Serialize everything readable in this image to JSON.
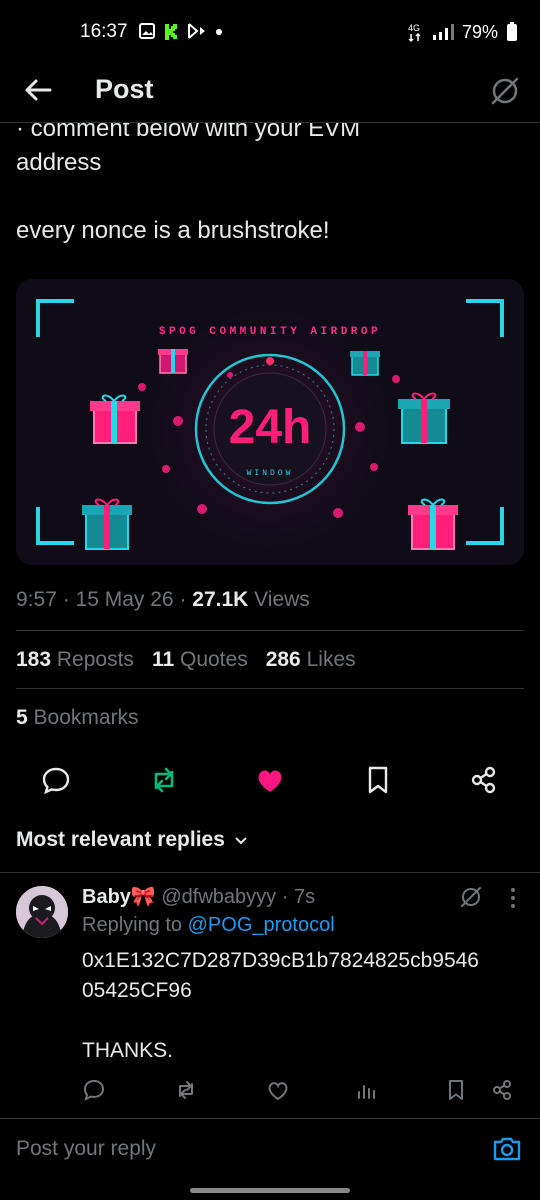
{
  "status_bar": {
    "time": "16:37",
    "network": "4G",
    "battery": "79%"
  },
  "header": {
    "title": "Post"
  },
  "tweet": {
    "text": "· comment below with your EVM\naddress\n\nevery nonce is a brushstroke!"
  },
  "media": {
    "banner": "$POG COMMUNITY AIRDROP",
    "big": "24h",
    "sub": "WINDOW"
  },
  "meta": {
    "time": "9:57",
    "date": "15 May 26",
    "views_count": "27.1K",
    "views_label": "Views"
  },
  "stats": {
    "reposts_count": "183",
    "reposts_label": "Reposts",
    "quotes_count": "11",
    "quotes_label": "Quotes",
    "likes_count": "286",
    "likes_label": "Likes",
    "bookmarks_count": "5",
    "bookmarks_label": "Bookmarks"
  },
  "replies_sort": {
    "label": "Most relevant replies"
  },
  "reply": {
    "name": "Baby🎀",
    "handle": "@dfwbabyyy",
    "age": "7s",
    "replying_prefix": "Replying to",
    "replying_to": "@POG_protocol",
    "body": "0x1E132C7D287D39cB1b7824825cb9546\n05425CF96\n\nTHANKS."
  },
  "composer": {
    "placeholder": "Post your reply"
  },
  "colors": {
    "accent_blue": "#1d9bf0",
    "repost_green": "#00ba7c",
    "like_pink": "#f91880",
    "muted": "#71767b"
  }
}
